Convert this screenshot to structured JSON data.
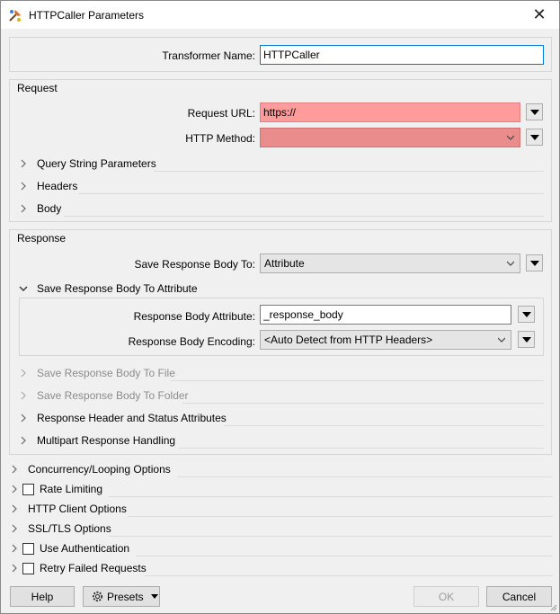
{
  "window": {
    "title": "HTTPCaller Parameters",
    "close_glyph": "✕"
  },
  "transformer": {
    "label": "Transformer Name:",
    "value": "HTTPCaller"
  },
  "request": {
    "group_label": "Request",
    "url_label": "Request URL:",
    "url_value": "https://",
    "method_label": "HTTP Method:",
    "method_value": "",
    "sections": [
      "Query String Parameters",
      "Headers",
      "Body"
    ]
  },
  "response": {
    "group_label": "Response",
    "save_to_label": "Save Response Body To:",
    "save_to_value": "Attribute",
    "attr_section_label": "Save Response Body To Attribute",
    "body_attr_label": "Response Body Attribute:",
    "body_attr_value": "_response_body",
    "encoding_label": "Response Body Encoding:",
    "encoding_value": "<Auto Detect from HTTP Headers>",
    "sections": [
      {
        "label": "Save Response Body To File",
        "disabled": true
      },
      {
        "label": "Save Response Body To Folder",
        "disabled": true
      },
      {
        "label": "Response Header and Status Attributes",
        "disabled": false
      },
      {
        "label": "Multipart Response Handling",
        "disabled": false
      }
    ]
  },
  "options": [
    {
      "label": "Concurrency/Looping Options",
      "checkbox": false
    },
    {
      "label": "Rate Limiting",
      "checkbox": true
    },
    {
      "label": "HTTP Client Options",
      "checkbox": false
    },
    {
      "label": "SSL/TLS Options",
      "checkbox": false
    },
    {
      "label": "Use Authentication",
      "checkbox": true
    },
    {
      "label": "Retry Failed Requests",
      "checkbox": true
    }
  ],
  "footer": {
    "help": "Help",
    "presets": "Presets",
    "ok": "OK",
    "cancel": "Cancel"
  },
  "colors": {
    "error_input": "#ff9b9b",
    "error_combo": "#ea8c8c",
    "focus_border": "#0078d7"
  }
}
